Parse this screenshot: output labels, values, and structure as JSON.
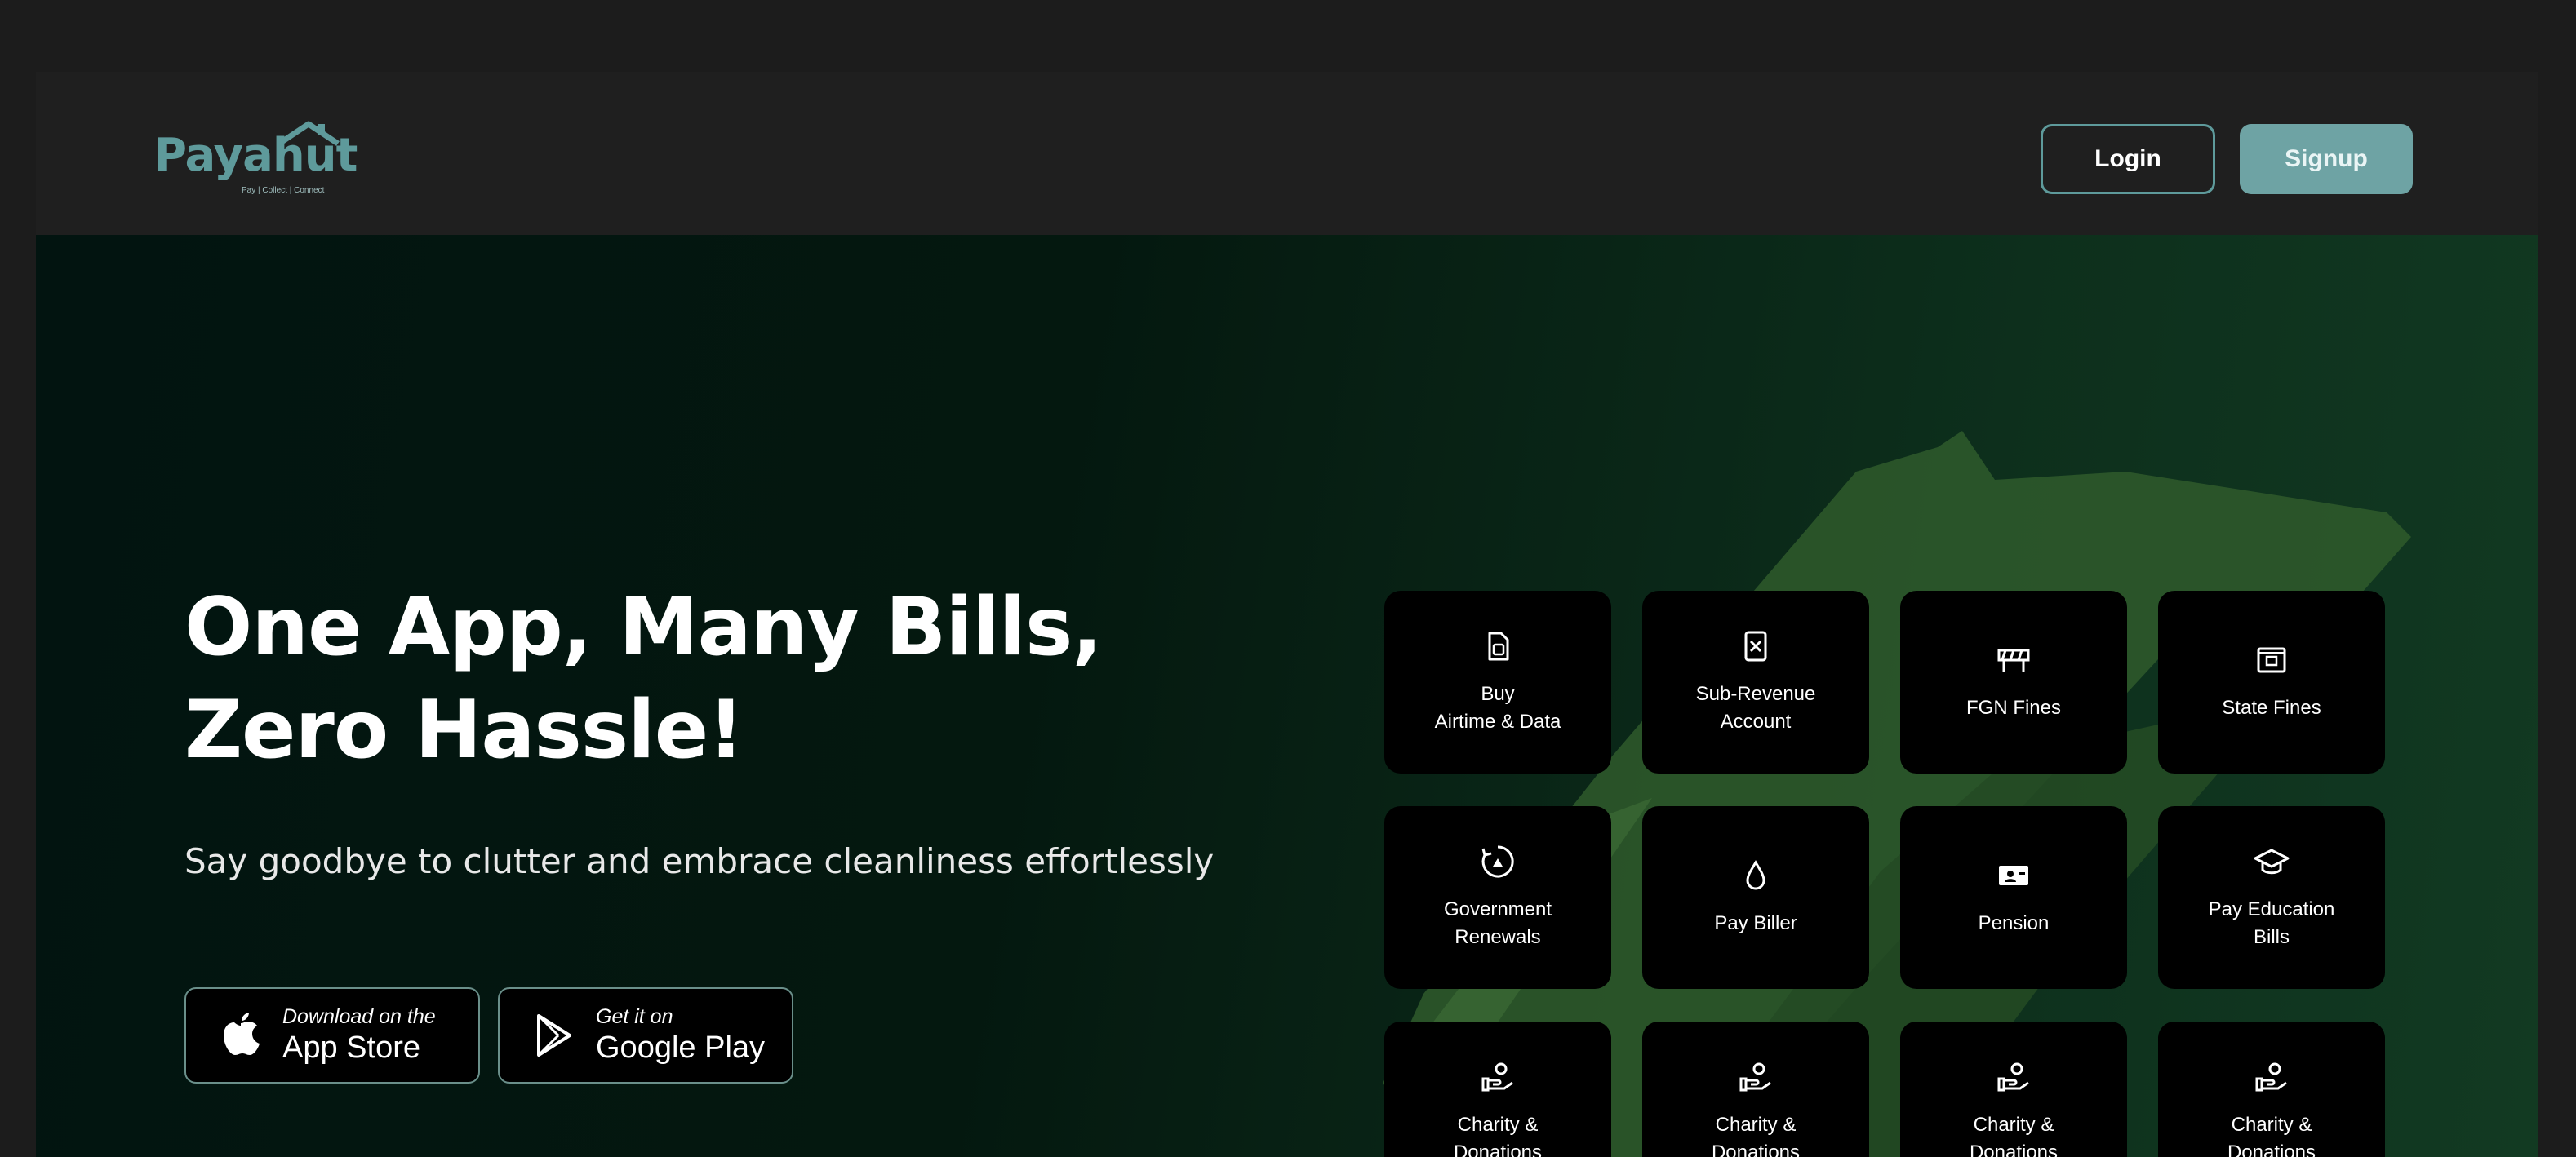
{
  "header": {
    "logo_text": "Payahut",
    "logo_tagline": "Pay | Collect | Connect",
    "login_label": "Login",
    "signup_label": "Signup"
  },
  "hero": {
    "headline_line1": "One App, Many Bills,",
    "headline_line2": "Zero Hassle!",
    "subline": "Say goodbye to clutter and embrace cleanliness effortlessly",
    "app_store": {
      "small": "Download on the",
      "big": "App Store"
    },
    "google_play": {
      "small": "Get it on",
      "big": "Google Play"
    }
  },
  "services": [
    {
      "label": "Buy\nAirtime & Data",
      "icon": "sim-card-icon"
    },
    {
      "label": "Sub-Revenue\nAccount",
      "icon": "receipt-icon"
    },
    {
      "label": "FGN Fines",
      "icon": "roadblock-icon"
    },
    {
      "label": "State Fines",
      "icon": "ticket-icon"
    },
    {
      "label": "Government\nRenewals",
      "icon": "renew-icon"
    },
    {
      "label": "Pay Biller",
      "icon": "drop-icon"
    },
    {
      "label": "Pension",
      "icon": "pension-icon"
    },
    {
      "label": "Pay Education\nBills",
      "icon": "graduation-cap-icon"
    },
    {
      "label": "Charity &\nDonations",
      "icon": "donation-hand-icon"
    },
    {
      "label": "Charity &\nDonations",
      "icon": "donation-hand-icon"
    },
    {
      "label": "Charity &\nDonations",
      "icon": "donation-hand-icon"
    },
    {
      "label": "Charity &\nDonations",
      "icon": "donation-hand-icon"
    }
  ],
  "colors": {
    "brand": "#5e9a9b",
    "signup_bg": "#6ea3a4",
    "card_bg": "#000000",
    "brush": "#2f5a2c"
  }
}
